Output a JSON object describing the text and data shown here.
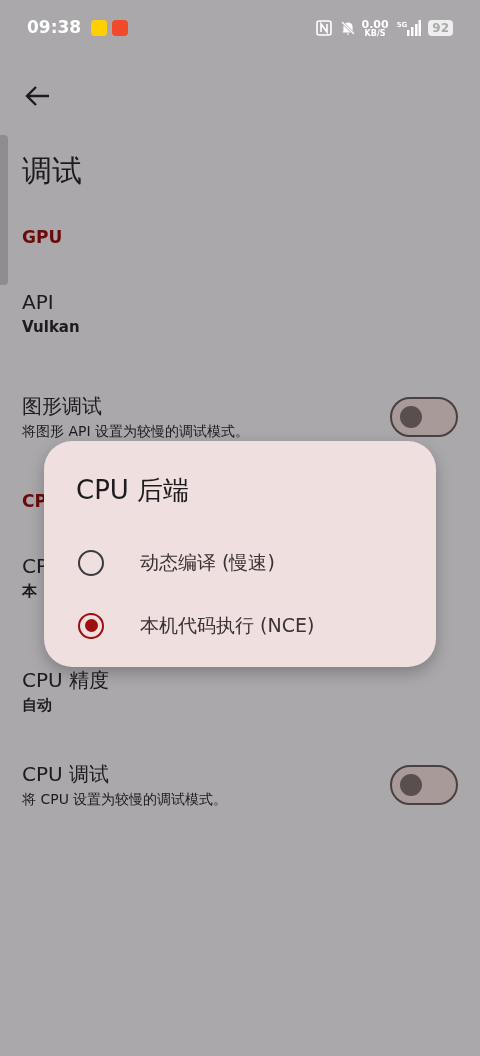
{
  "status_bar": {
    "time": "09:38",
    "app_icons": [
      {
        "kind": "meituan"
      },
      {
        "kind": "shop"
      }
    ],
    "net_speed": "0.00",
    "net_unit": "KB/S",
    "network": "5G",
    "battery": "92"
  },
  "title": "调试",
  "sections": [
    {
      "header": "GPU",
      "items": [
        {
          "kind": "value",
          "title": "API",
          "value": "Vulkan"
        },
        {
          "kind": "toggle",
          "title": "图形调试",
          "subtitle": "将图形 API 设置为较慢的调试模式。",
          "on": false
        }
      ]
    },
    {
      "header": "CP",
      "items": [
        {
          "kind": "value",
          "title": "CP",
          "value": "本"
        },
        {
          "kind": "value",
          "title": "CPU 精度",
          "value": "自动"
        },
        {
          "kind": "toggle",
          "title": "CPU 调试",
          "subtitle": "将 CPU 设置为较慢的调试模式。",
          "on": false
        }
      ]
    }
  ],
  "dialog": {
    "title": "CPU 后端",
    "options": [
      {
        "label": "动态编译 (慢速)",
        "selected": false
      },
      {
        "label": "本机代码执行 (NCE)",
        "selected": true
      }
    ]
  }
}
